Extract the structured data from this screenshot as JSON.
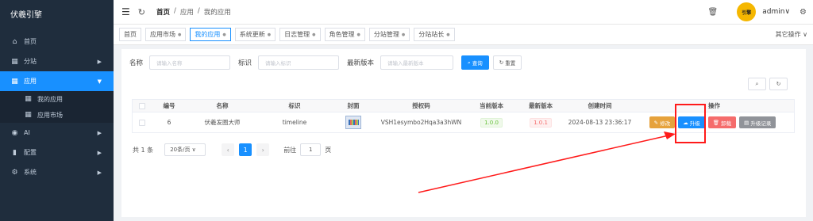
{
  "sidebar": {
    "brand": "伏羲引擎",
    "items": [
      {
        "label": "首页",
        "icon": "home-icon",
        "glyph": "⌂"
      },
      {
        "label": "分站",
        "icon": "site-icon",
        "glyph": "▦"
      },
      {
        "label": "应用",
        "icon": "apps-icon",
        "glyph": "▦"
      },
      {
        "label": "AI",
        "icon": "ai-icon",
        "glyph": "◉"
      },
      {
        "label": "配置",
        "icon": "config-icon",
        "glyph": "▮"
      },
      {
        "label": "系统",
        "icon": "system-icon",
        "glyph": "⚙"
      }
    ],
    "subitems": [
      {
        "label": "我的应用",
        "icon": "grid-icon"
      },
      {
        "label": "应用市场",
        "icon": "grid-icon"
      }
    ]
  },
  "header": {
    "breadcrumb": [
      "首页",
      "应用",
      "我的应用"
    ],
    "avatar_text": "引擎",
    "username": "admin"
  },
  "tabs": [
    {
      "label": "首页",
      "dropdown": false
    },
    {
      "label": "应用市场",
      "dropdown": true
    },
    {
      "label": "我的应用",
      "dropdown": true,
      "active": true
    },
    {
      "label": "系统更新",
      "dropdown": true
    },
    {
      "label": "日志管理",
      "dropdown": true
    },
    {
      "label": "角色管理",
      "dropdown": true
    },
    {
      "label": "分站管理",
      "dropdown": true
    },
    {
      "label": "分站站长",
      "dropdown": true
    }
  ],
  "other_ops": "其它操作",
  "search": {
    "name_label": "名称",
    "name_placeholder": "请输入名称",
    "id_label": "标识",
    "id_placeholder": "请输入标识",
    "ver_label": "最新版本",
    "ver_placeholder": "请输入最新版本",
    "query": "查询",
    "reset": "重置"
  },
  "table": {
    "headers": [
      "编号",
      "名称",
      "标识",
      "封面",
      "授权码",
      "当前版本",
      "最新版本",
      "创建时间",
      "操作"
    ],
    "rows": [
      {
        "id": "6",
        "name": "伏羲发圈大师",
        "key": "timeline",
        "code": "VSH1esymbo2Hqa3a3hWN",
        "current": "1.0.0",
        "latest": "1.0.1",
        "created": "2024-08-13 23:36:17",
        "ops": {
          "edit": "修改",
          "upgrade": "升级",
          "uninstall": "卸载",
          "log": "升级记录"
        }
      }
    ]
  },
  "pager": {
    "total": "共 1 条",
    "page_size": "20条/页",
    "current_page": "1",
    "goto": "前往",
    "goto_value": "1",
    "page_unit": "页"
  },
  "colors": {
    "accent": "#1890ff",
    "sidebar": "#1f2d3d",
    "annotation": "#ff1a1a"
  }
}
